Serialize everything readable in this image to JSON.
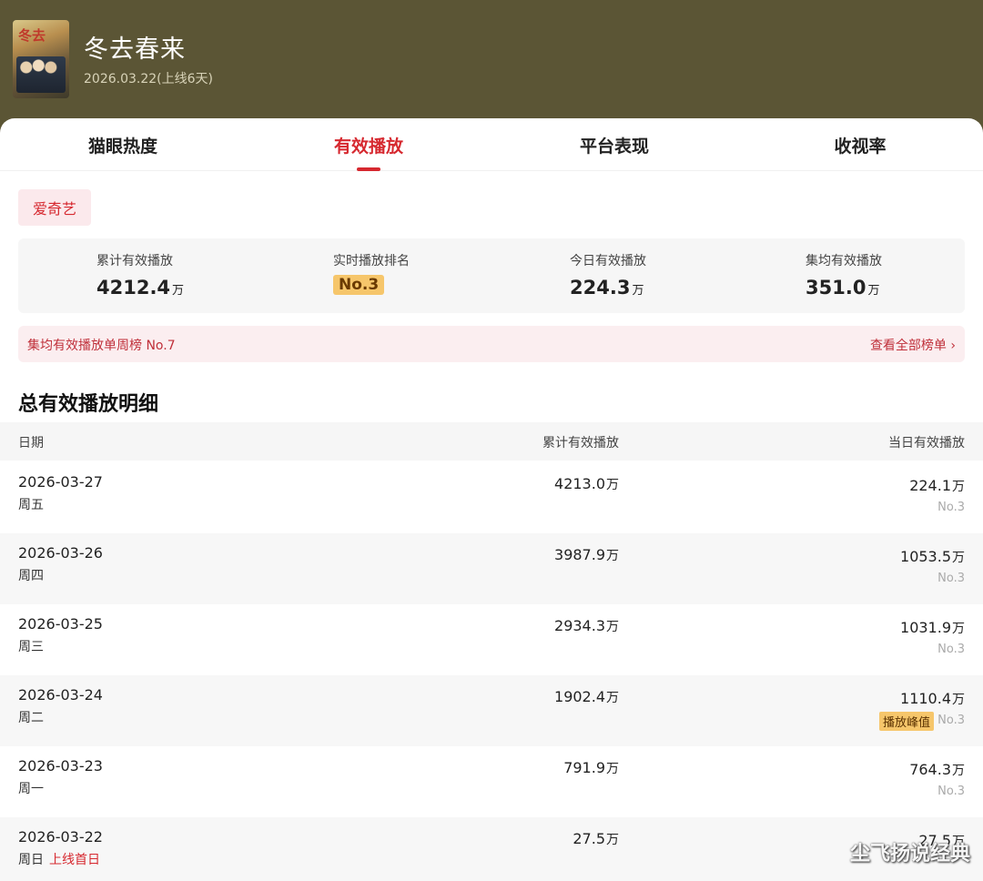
{
  "header": {
    "title": "冬去春来",
    "subtitle": "2026.03.22(上线6天)",
    "poster_text": "冬去"
  },
  "tabs": [
    {
      "label": "猫眼热度",
      "active": false
    },
    {
      "label": "有效播放",
      "active": true
    },
    {
      "label": "平台表现",
      "active": false
    },
    {
      "label": "收视率",
      "active": false
    }
  ],
  "platform": "爱奇艺",
  "stats": {
    "cumulative": {
      "label": "累计有效播放",
      "value": "4212.4",
      "unit": "万"
    },
    "rank": {
      "label": "实时播放排名",
      "value": "No.3"
    },
    "today": {
      "label": "今日有效播放",
      "value": "224.3",
      "unit": "万"
    },
    "avg": {
      "label": "集均有效播放",
      "value": "351.0",
      "unit": "万"
    }
  },
  "weekly": {
    "text": "集均有效播放单周榜 No.7",
    "link": "查看全部榜单 ›"
  },
  "section_title": "总有效播放明细",
  "table": {
    "headers": {
      "date": "日期",
      "total": "累计有效播放",
      "daily": "当日有效播放"
    },
    "rows": [
      {
        "date": "2026-03-27",
        "weekday": "周五",
        "tag": "",
        "total": "4213.0",
        "daily": "224.1",
        "rank": "No.3",
        "peak": ""
      },
      {
        "date": "2026-03-26",
        "weekday": "周四",
        "tag": "",
        "total": "3987.9",
        "daily": "1053.5",
        "rank": "No.3",
        "peak": ""
      },
      {
        "date": "2026-03-25",
        "weekday": "周三",
        "tag": "",
        "total": "2934.3",
        "daily": "1031.9",
        "rank": "No.3",
        "peak": ""
      },
      {
        "date": "2026-03-24",
        "weekday": "周二",
        "tag": "",
        "total": "1902.4",
        "daily": "1110.4",
        "rank": "No.3",
        "peak": "播放峰值"
      },
      {
        "date": "2026-03-23",
        "weekday": "周一",
        "tag": "",
        "total": "791.9",
        "daily": "764.3",
        "rank": "No.3",
        "peak": ""
      },
      {
        "date": "2026-03-22",
        "weekday": "周日",
        "tag": "上线首日",
        "total": "27.5",
        "daily": "27.5",
        "rank": "",
        "peak": ""
      }
    ],
    "unit": "万"
  },
  "watermark": "尘飞扬说经典",
  "colors": {
    "accent": "#d6282f",
    "header_bg": "#5b5535",
    "badge": "#f6c66b"
  }
}
